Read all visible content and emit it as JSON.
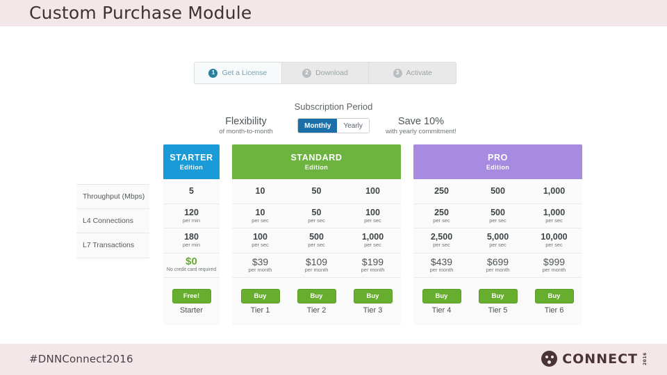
{
  "slide": {
    "title": "Custom Purchase Module",
    "footer_tag": "#DNNConnect2016",
    "logo": {
      "word": "CONNECT",
      "sub": "2016",
      "mark": "connect-circle-logo"
    }
  },
  "steps": [
    {
      "num": "1",
      "label": "Get a License",
      "active": true
    },
    {
      "num": "2",
      "label": "Download",
      "active": false
    },
    {
      "num": "3",
      "label": "Activate",
      "active": false
    }
  ],
  "subscription": {
    "title": "Subscription Period",
    "left": {
      "big": "Flexibility",
      "small": "of month-to-month"
    },
    "right": {
      "big": "Save 10%",
      "small": "with yearly commitment!"
    },
    "toggle": {
      "on": "Monthly",
      "off": "Yearly",
      "selected": "Monthly",
      "on_color": "#1b6fa8"
    }
  },
  "pricing": {
    "features": [
      "Throughput (Mbps)",
      "L4 Connections",
      "L7 Transactions"
    ],
    "plans": [
      {
        "name": "STARTER",
        "edition": "Edition",
        "color": "#1a9bd7",
        "tiers": [
          {
            "throughput": "5",
            "throughput_unit": "",
            "l4": "120",
            "l4_unit": "per min",
            "l7": "180",
            "l7_unit": "per min",
            "price": "$0",
            "price_unit": "No credit card required",
            "free": true,
            "button": "Free!",
            "tier_label": "Starter"
          }
        ]
      },
      {
        "name": "STANDARD",
        "edition": "Edition",
        "color": "#6cb33f",
        "tiers": [
          {
            "throughput": "10",
            "throughput_unit": "",
            "l4": "10",
            "l4_unit": "per sec",
            "l7": "100",
            "l7_unit": "per sec",
            "price": "$39",
            "price_unit": "per month",
            "free": false,
            "button": "Buy",
            "tier_label": "Tier 1"
          },
          {
            "throughput": "50",
            "throughput_unit": "",
            "l4": "50",
            "l4_unit": "per sec",
            "l7": "500",
            "l7_unit": "per sec",
            "price": "$109",
            "price_unit": "per month",
            "free": false,
            "button": "Buy",
            "tier_label": "Tier 2"
          },
          {
            "throughput": "100",
            "throughput_unit": "",
            "l4": "100",
            "l4_unit": "per sec",
            "l7": "1,000",
            "l7_unit": "per sec",
            "price": "$199",
            "price_unit": "per month",
            "free": false,
            "button": "Buy",
            "tier_label": "Tier 3"
          }
        ]
      },
      {
        "name": "PRO",
        "edition": "Edition",
        "color": "#a78be0",
        "tiers": [
          {
            "throughput": "250",
            "throughput_unit": "",
            "l4": "250",
            "l4_unit": "per sec",
            "l7": "2,500",
            "l7_unit": "per sec",
            "price": "$439",
            "price_unit": "per month",
            "free": false,
            "button": "Buy",
            "tier_label": "Tier 4"
          },
          {
            "throughput": "500",
            "throughput_unit": "",
            "l4": "500",
            "l4_unit": "per sec",
            "l7": "5,000",
            "l7_unit": "per sec",
            "price": "$699",
            "price_unit": "per month",
            "free": false,
            "button": "Buy",
            "tier_label": "Tier 5"
          },
          {
            "throughput": "1,000",
            "throughput_unit": "",
            "l4": "1,000",
            "l4_unit": "per sec",
            "l7": "10,000",
            "l7_unit": "per sec",
            "price": "$999",
            "price_unit": "per month",
            "free": false,
            "button": "Buy",
            "tier_label": "Tier 6"
          }
        ]
      }
    ]
  }
}
